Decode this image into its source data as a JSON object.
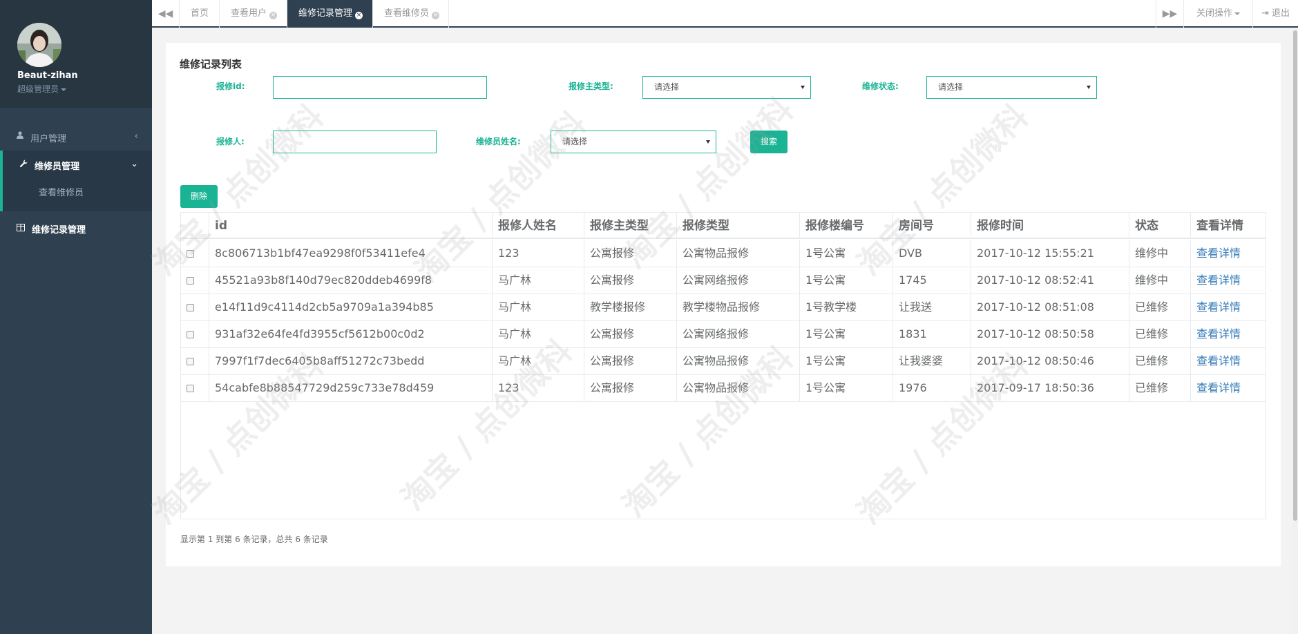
{
  "sidebar": {
    "user_name": "Beaut-zihan",
    "user_role": "超级管理员",
    "nav": {
      "users": "用户管理",
      "repairman": "维修员管理",
      "repairman_sub": "查看维修员",
      "records": "维修记录管理"
    }
  },
  "tabs": {
    "items": [
      {
        "label": "首页"
      },
      {
        "label": "查看用户"
      },
      {
        "label": "维修记录管理"
      },
      {
        "label": "查看维修员"
      }
    ],
    "close_ops": "关闭操作",
    "logout": "退出"
  },
  "panel": {
    "title": "维修记录列表",
    "filters": {
      "repair_id_label": "报修id:",
      "repair_id_value": "",
      "main_type_label": "报修主类型:",
      "main_type_value": "请选择",
      "status_label": "维修状态:",
      "status_value": "请选择",
      "reporter_label": "报修人:",
      "reporter_value": "",
      "repairman_label": "维修员姓名:",
      "repairman_value": "请选择",
      "search_button": "搜索"
    },
    "delete_button": "删除"
  },
  "table": {
    "headers": [
      "id",
      "报修人姓名",
      "报修主类型",
      "报修类型",
      "报修楼编号",
      "房间号",
      "报修时间",
      "状态",
      "查看详情"
    ],
    "rows": [
      [
        "8c806713b1bf47ea9298f0f53411efe4",
        "123",
        "公寓报修",
        "公寓物品报修",
        "1号公寓",
        "DVB",
        "2017-10-12 15:55:21",
        "维修中",
        "查看详情"
      ],
      [
        "45521a93b8f140d79ec820ddeb4699f8",
        "马广林",
        "公寓报修",
        "公寓网络报修",
        "1号公寓",
        "1745",
        "2017-10-12 08:52:41",
        "维修中",
        "查看详情"
      ],
      [
        "e14f11d9c4114d2cb5a9709a1a394b85",
        "马广林",
        "教学楼报修",
        "教学楼物品报修",
        "1号教学楼",
        "让我送",
        "2017-10-12 08:51:08",
        "已维修",
        "查看详情"
      ],
      [
        "931af32e64fe4fd3955cf5612b00c0d2",
        "马广林",
        "公寓报修",
        "公寓网络报修",
        "1号公寓",
        "1831",
        "2017-10-12 08:50:58",
        "已维修",
        "查看详情"
      ],
      [
        "7997f1f7dec6405b8aff51272c73bedd",
        "马广林",
        "公寓报修",
        "公寓物品报修",
        "1号公寓",
        "让我婆婆",
        "2017-10-12 08:50:46",
        "已维修",
        "查看详情"
      ],
      [
        "54cabfe8b88547729d259c733e78d459",
        "123",
        "公寓报修",
        "公寓物品报修",
        "1号公寓",
        "1976",
        "2017-09-17 18:50:36",
        "已维修",
        "查看详情"
      ]
    ]
  },
  "pagination": {
    "summary": "显示第 1 到第 6 条记录，总共 6 条记录"
  },
  "watermark": "淘宝 / 点创微科",
  "colors": {
    "sidebar": "#2f4050",
    "accent": "#1ab394",
    "link": "#337ab7"
  }
}
